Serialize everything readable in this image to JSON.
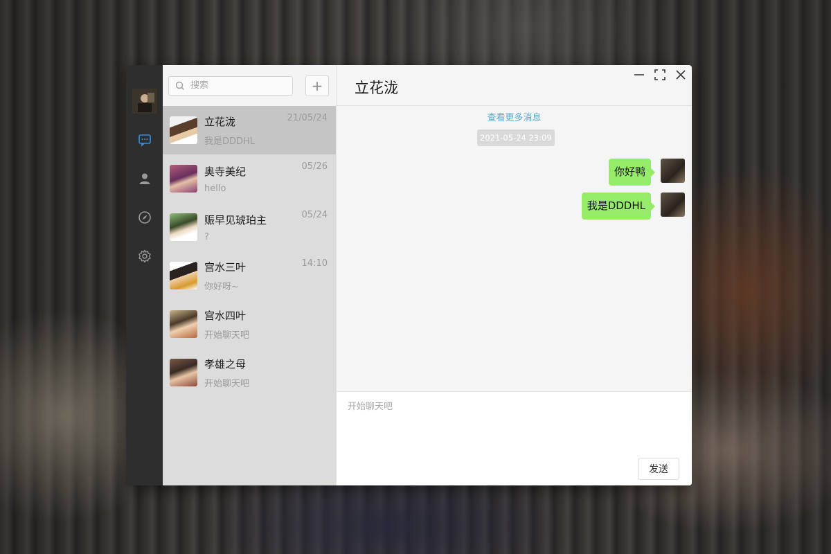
{
  "search": {
    "placeholder": "搜索"
  },
  "add_label": "+",
  "conversations": [
    {
      "name": "立花泷",
      "preview": "我是DDDHL",
      "time": "21/05/24"
    },
    {
      "name": "奥寺美纪",
      "preview": "hello",
      "time": "05/26"
    },
    {
      "name": "赈早见琥珀主",
      "preview": "?",
      "time": "05/24"
    },
    {
      "name": "宫水三叶",
      "preview": "你好呀~",
      "time": "14:10"
    },
    {
      "name": "宫水四叶",
      "preview": "开始聊天吧",
      "time": ""
    },
    {
      "name": "孝雄之母",
      "preview": "开始聊天吧",
      "time": ""
    }
  ],
  "chat": {
    "title": "立花泷",
    "more_link": "查看更多消息",
    "timestamp": "2021-05-24 23:09",
    "messages": [
      {
        "text": "你好鸭"
      },
      {
        "text": "我是DDDHL"
      }
    ]
  },
  "composer": {
    "placeholder": "开始聊天吧",
    "send_label": "发送"
  },
  "colors": {
    "sidebar_bg": "#2e2e2e",
    "active_nav": "#3b8fd9",
    "bubble_green": "#95ec69",
    "link_blue": "#5aa8c8"
  }
}
